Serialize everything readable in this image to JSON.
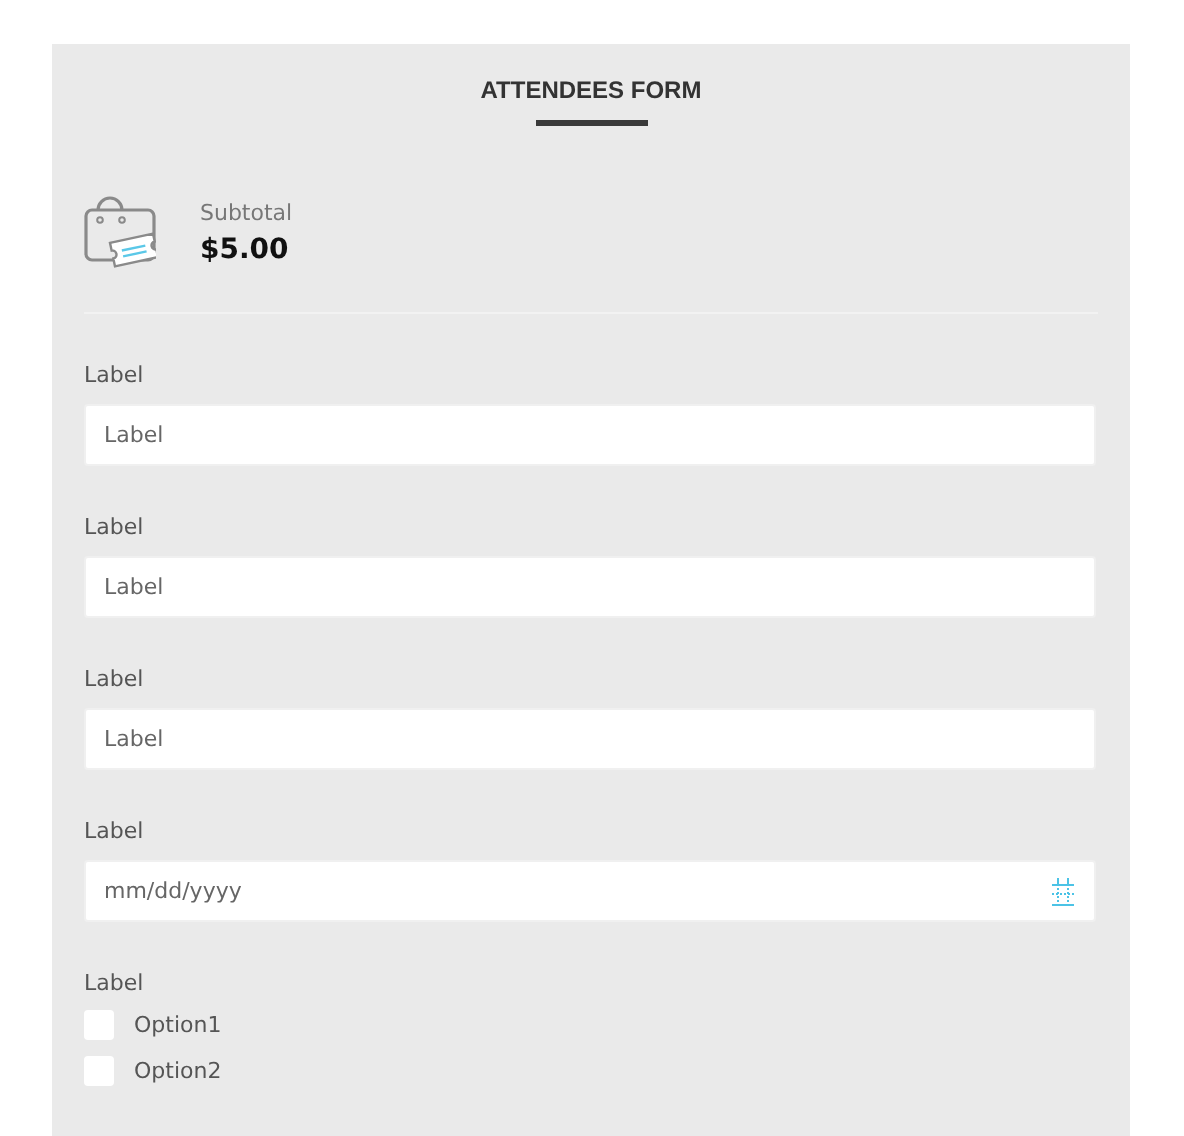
{
  "form": {
    "title": "ATTENDEES FORM"
  },
  "summary": {
    "label": "Subtotal",
    "amount": "$5.00"
  },
  "fields": [
    {
      "kind": "text",
      "label": "Label",
      "placeholder": "Label"
    },
    {
      "kind": "text",
      "label": "Label",
      "placeholder": "Label"
    },
    {
      "kind": "text",
      "label": "Label",
      "placeholder": "Label"
    },
    {
      "kind": "date",
      "label": "Label",
      "placeholder": "mm/dd/yyyy"
    },
    {
      "kind": "checkboxes",
      "label": "Label",
      "options": [
        {
          "label": "Option1",
          "checked": false
        },
        {
          "label": "Option2",
          "checked": false
        }
      ]
    }
  ]
}
